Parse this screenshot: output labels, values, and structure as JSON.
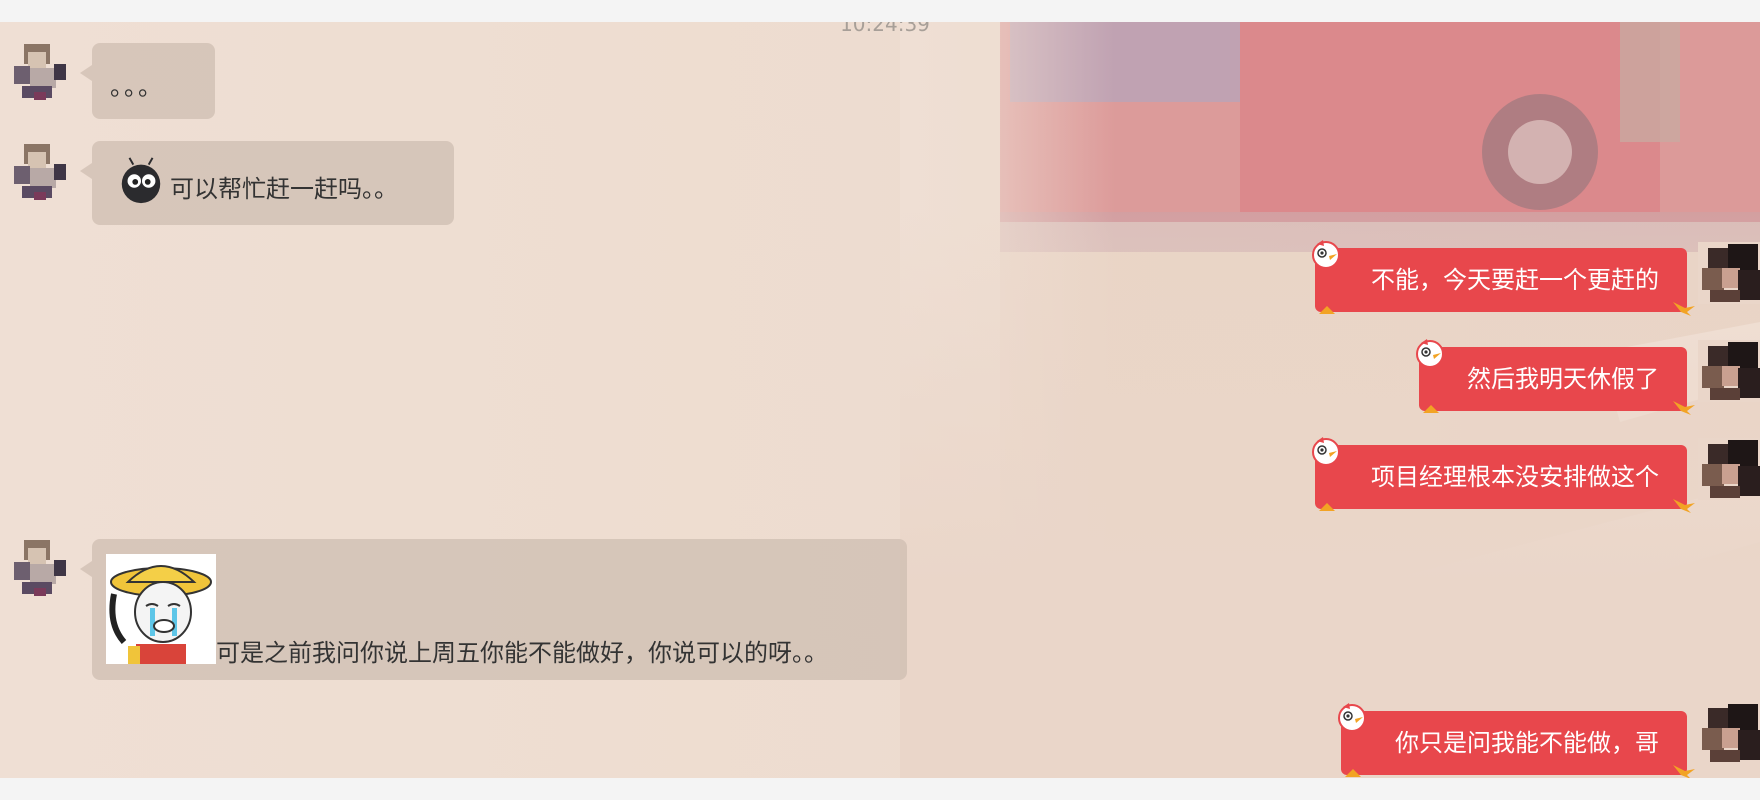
{
  "chat": {
    "timestamp": "10:24:39",
    "messages": [
      {
        "side": "in",
        "text": "。。。"
      },
      {
        "side": "in",
        "text": "可以帮忙赶一赶吗。。",
        "emoji": "bug-eyes-emoji"
      },
      {
        "side": "out",
        "text": "不能，今天要赶一个更赶的"
      },
      {
        "side": "out",
        "text": "然后我明天休假了"
      },
      {
        "side": "out",
        "text": "项目经理根本没安排做这个"
      },
      {
        "side": "in",
        "text": "可是之前我问你说上周五你能不能做好，你说可以的呀。。",
        "sticker": "crying-face-sticker"
      },
      {
        "side": "out",
        "text": "你只是问我能不能做，哥"
      }
    ]
  },
  "colors": {
    "outgoing_bubble": "#e8474c",
    "incoming_bubble": "#d3c1b5",
    "chat_background": "#efdfd4",
    "frame": "#f4f4f4"
  },
  "icons": {
    "outgoing_decoration": "cartoon-bird-icon",
    "sender_avatar": "pixelated-avatar-icon",
    "self_avatar": "pixelated-avatar-icon"
  }
}
